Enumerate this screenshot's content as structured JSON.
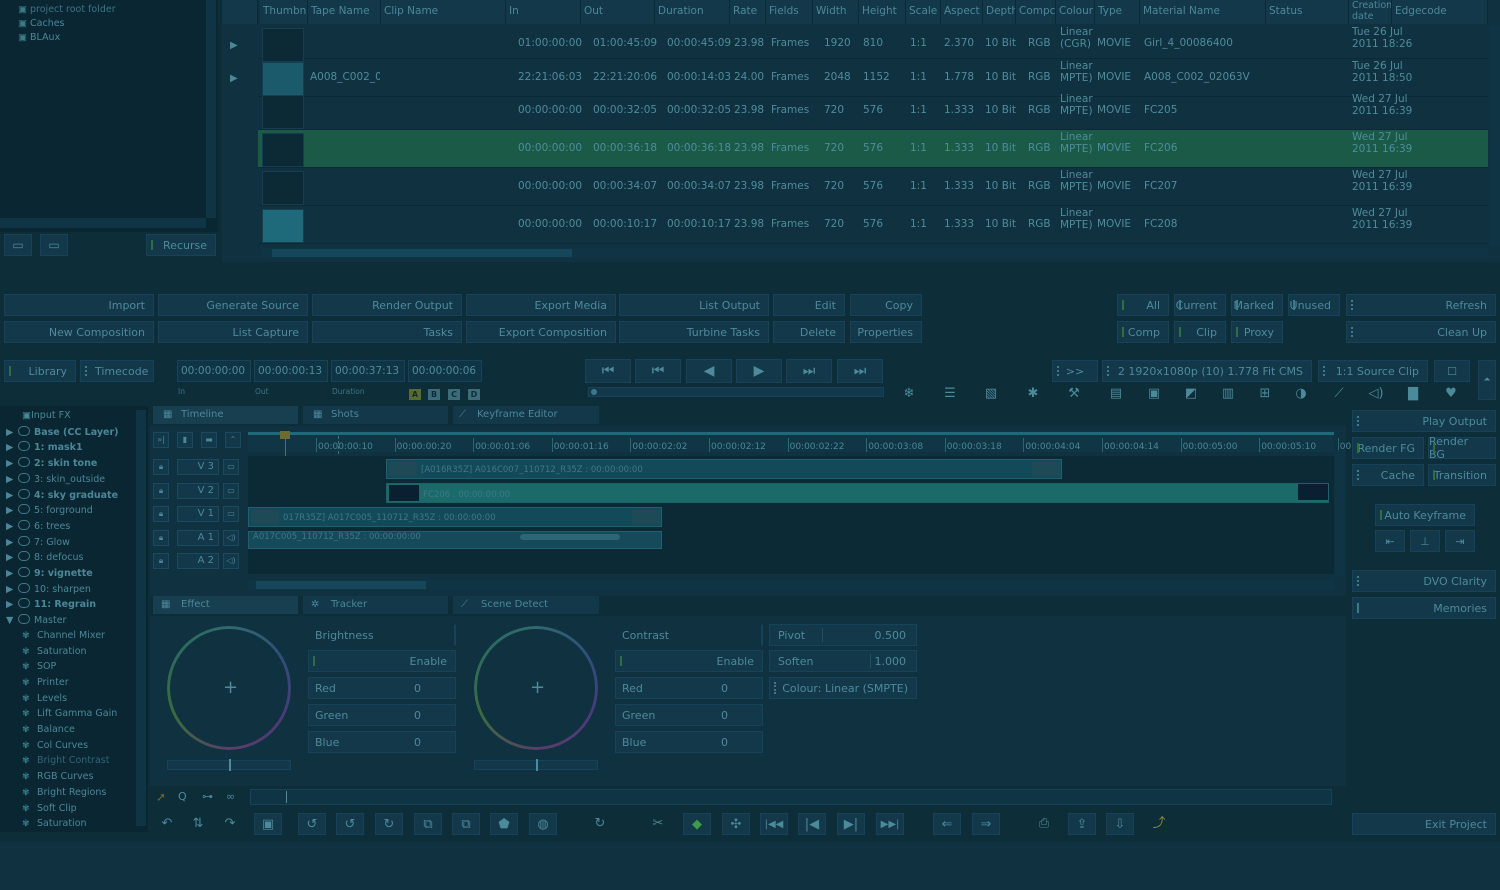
{
  "folders": [
    "project root folder",
    "Caches",
    "BLAux"
  ],
  "recurse_label": "Recurse",
  "table": {
    "headers": [
      "Thumbn",
      "Tape Name",
      "Clip Name",
      "In",
      "Out",
      "Duration",
      "Rate",
      "Fields",
      "Width",
      "Height",
      "Scale",
      "Aspect",
      "Depth",
      "Compc",
      "Colour",
      "Type",
      "Material Name",
      "Status",
      "Creation date",
      "Edgecode"
    ],
    "rows": [
      {
        "tape": "",
        "in": "01:00:00:00",
        "out": "01:00:45:09",
        "dur": "00:00:45:09",
        "rate": "23.98",
        "fields": "Frames",
        "width": "1920",
        "height": "810",
        "scale": "1:1",
        "aspect": "2.370",
        "depth": "10 Bit",
        "comp": "RGB",
        "colour1": "Linear",
        "colour2": "(CGR)",
        "type": "MOVIE",
        "material": "Girl_4_00086400",
        "date1": "Tue 26 Jul",
        "date2": "2011 18:26"
      },
      {
        "tape": "A008_C002_0",
        "in": "22:21:06:03",
        "out": "22:21:20:06",
        "dur": "00:00:14:03",
        "rate": "24.00",
        "fields": "Frames",
        "width": "2048",
        "height": "1152",
        "scale": "1:1",
        "aspect": "1.778",
        "depth": "10 Bit",
        "comp": "RGB",
        "colour1": "Linear",
        "colour2": "MPTE)",
        "type": "MOVIE",
        "material": "A008_C002_02063V",
        "date1": "Tue 26 Jul",
        "date2": "2011 18:50"
      },
      {
        "tape": "",
        "in": "00:00:00:00",
        "out": "00:00:32:05",
        "dur": "00:00:32:05",
        "rate": "23.98",
        "fields": "Frames",
        "width": "720",
        "height": "576",
        "scale": "1:1",
        "aspect": "1.333",
        "depth": "10 Bit",
        "comp": "RGB",
        "colour1": "Linear",
        "colour2": "MPTE)",
        "type": "MOVIE",
        "material": "FC205",
        "date1": "Wed 27 Jul",
        "date2": "2011 16:39"
      },
      {
        "tape": "",
        "in": "00:00:00:00",
        "out": "00:00:36:18",
        "dur": "00:00:36:18",
        "rate": "23.98",
        "fields": "Frames",
        "width": "720",
        "height": "576",
        "scale": "1:1",
        "aspect": "1.333",
        "depth": "10 Bit",
        "comp": "RGB",
        "colour1": "Linear",
        "colour2": "MPTE)",
        "type": "MOVIE",
        "material": "FC206",
        "date1": "Wed 27 Jul",
        "date2": "2011 16:39"
      },
      {
        "tape": "",
        "in": "00:00:00:00",
        "out": "00:00:34:07",
        "dur": "00:00:34:07",
        "rate": "23.98",
        "fields": "Frames",
        "width": "720",
        "height": "576",
        "scale": "1:1",
        "aspect": "1.333",
        "depth": "10 Bit",
        "comp": "RGB",
        "colour1": "Linear",
        "colour2": "MPTE)",
        "type": "MOVIE",
        "material": "FC207",
        "date1": "Wed 27 Jul",
        "date2": "2011 16:39"
      },
      {
        "tape": "",
        "in": "00:00:00:00",
        "out": "00:00:10:17",
        "dur": "00:00:10:17",
        "rate": "23.98",
        "fields": "Frames",
        "width": "720",
        "height": "576",
        "scale": "1:1",
        "aspect": "1.333",
        "depth": "10 Bit",
        "comp": "RGB",
        "colour1": "Linear",
        "colour2": "MPTE)",
        "type": "MOVIE",
        "material": "FC208",
        "date1": "Wed 27 Jul",
        "date2": "2011 16:39"
      }
    ]
  },
  "actions_row1": [
    "Import",
    "Generate Source",
    "Render Output",
    "Export Media",
    "List Output",
    "Edit",
    "Copy"
  ],
  "actions_row2": [
    "New Composition",
    "List Capture",
    "Tasks",
    "Export Composition",
    "Turbine Tasks",
    "Delete",
    "Properties"
  ],
  "filters_row1": [
    "All",
    "Current",
    "Marked",
    "Unused"
  ],
  "filters_row2": [
    "Comp",
    "Clip",
    "Proxy"
  ],
  "refresh_label": "Refresh",
  "cleanup_label": "Clean Up",
  "library_label": "Library",
  "timecode_label": "Timecode",
  "timecodes": {
    "in": "00:00:00:00",
    "out": "00:00:00:13",
    "duration": "00:00:37:13",
    "extra": "00:00:00:06"
  },
  "timecode_labels": {
    "in": "In",
    "out": "Out",
    "duration": "Duration"
  },
  "abcd": [
    "A",
    "B",
    "C",
    "D"
  ],
  "format_forward": ">>",
  "format_label": "2  1920x1080p (10) 1.778 Fit CMS",
  "source_label": "1:1 Source Clip",
  "stack": [
    "Input FX",
    "Base (CC Layer)",
    "1: mask1",
    "2: skin tone",
    "3: skin_outside",
    "4: sky graduate",
    "5: forground",
    "6: trees",
    "7: Glow",
    "8: defocus",
    "9: vignette",
    "10: sharpen",
    "11: Regrain",
    "Master"
  ],
  "master_children": [
    "Channel Mixer",
    "Saturation",
    "SOP",
    "Printer",
    "Levels",
    "Lift Gamma Gain",
    "Balance",
    "Col Curves",
    "Bright Contrast",
    "RGB Curves",
    "Bright Regions",
    "Soft Clip",
    "Saturation"
  ],
  "tabs_top": [
    "Timeline",
    "Shots",
    "Keyframe Editor"
  ],
  "tabs_bottom": [
    "Effect",
    "Tracker",
    "Scene Detect"
  ],
  "ruler": [
    "00:00:00:10",
    "00:00:00:20",
    "00:00:01:06",
    "00:00:01:16",
    "00:00:02:02",
    "00:00:02:12",
    "00:00:02:22",
    "00:00:03:08",
    "00:00:03:18",
    "00:00:04:04",
    "00:00:04:14",
    "00:00:05:00",
    "00:00:05:10",
    "00"
  ],
  "tracks": [
    "V 3",
    "V 2",
    "V 1",
    "A 1",
    "A 2"
  ],
  "clips": {
    "v3": "[A016R35Z] A016C007_110712_R35Z : 00:00:00:00",
    "v2": "FC206 : 00:00:00:00",
    "v1": "017R35Z] A017C005_110712_R35Z : 00:00:00:00",
    "a1": "A017C005_110712_R35Z : 00:00:00:00"
  },
  "right_buttons": [
    "Play Output",
    "Render FG",
    "Render BG",
    "Cache",
    "Transition",
    "Auto Keyframe",
    "DVO Clarity",
    "Memories",
    "Exit Project"
  ],
  "effect": {
    "brightness": {
      "title": "Brightness",
      "enable": "Enable",
      "red_label": "Red",
      "red": "0",
      "green_label": "Green",
      "green": "0",
      "blue_label": "Blue",
      "blue": "0"
    },
    "contrast": {
      "title": "Contrast",
      "enable": "Enable",
      "red_label": "Red",
      "red": "0",
      "green_label": "Green",
      "green": "0",
      "blue_label": "Blue",
      "blue": "0"
    },
    "pivot_label": "Pivot",
    "pivot": "0.500",
    "soften_label": "Soften",
    "soften": "1.000",
    "colour_label": "Colour: Linear (SMPTE)"
  }
}
